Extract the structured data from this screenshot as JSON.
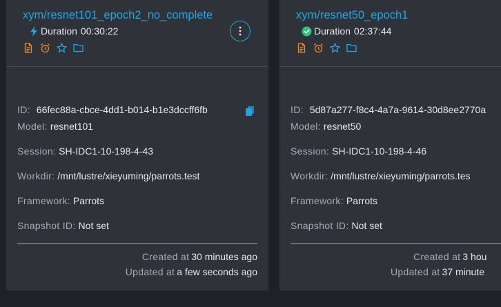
{
  "cards": [
    {
      "title": "xym/resnet101_epoch2_no_complete",
      "status": "running",
      "duration_label": "Duration",
      "duration_value": "00:30:22",
      "id_label": "ID:",
      "id_value": "66fec88a-cbce-4dd1-b014-b1e3dccff6fb",
      "model_label": "Model:",
      "model_value": "resnet101",
      "session_label": "Session:",
      "session_value": "SH-IDC1-10-198-4-43",
      "workdir_label": "Workdir:",
      "workdir_value": "/mnt/lustre/xieyuming/parrots.test",
      "framework_label": "Framework:",
      "framework_value": "Parrots",
      "snapshot_label": "Snapshot ID:",
      "snapshot_value": "Not set",
      "created_label": "Created at",
      "created_value": "30 minutes ago",
      "updated_label": "Updated at",
      "updated_value": "a few seconds ago"
    },
    {
      "title": "xym/resnet50_epoch1",
      "status": "completed",
      "duration_label": "Duration",
      "duration_value": "02:37:44",
      "id_label": "ID:",
      "id_value": "5d87a277-f8c4-4a7a-9614-30d8ee2770a",
      "model_label": "Model:",
      "model_value": "resnet50",
      "session_label": "Session:",
      "session_value": "SH-IDC1-10-198-4-46",
      "workdir_label": "Workdir:",
      "workdir_value": "/mnt/lustre/xieyuming/parrots.tes",
      "framework_label": "Framework:",
      "framework_value": "Parrots",
      "snapshot_label": "Snapshot ID:",
      "snapshot_value": "Not set",
      "created_label": "Created at",
      "created_value": "3 hou",
      "updated_label": "Updated at",
      "updated_value": "37 minute"
    }
  ],
  "icons": {
    "running_status": "lightning-icon",
    "completed_status": "check-circle-icon",
    "actions": [
      "file-icon",
      "alarm-icon",
      "star-icon",
      "folder-icon"
    ],
    "copy": "copy-icon",
    "more": "more-vertical-icon"
  },
  "colors": {
    "accent": "#25a4e0",
    "action_orange": "#f08a24",
    "success_green": "#2ec27e",
    "card_bg": "#2f3238",
    "page_bg": "#1e2127"
  }
}
